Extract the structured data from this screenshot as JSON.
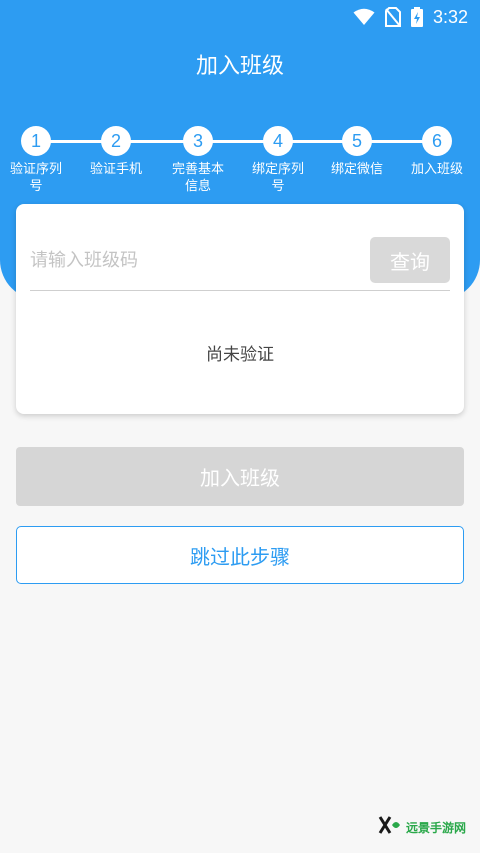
{
  "status_bar": {
    "time": "3:32",
    "icons": [
      "wifi-icon",
      "no-sim-icon",
      "battery-charging-icon"
    ]
  },
  "header": {
    "title": "加入班级",
    "accent_color": "#2d9cf2"
  },
  "steps": [
    {
      "number": "1",
      "label": "验证序列号"
    },
    {
      "number": "2",
      "label": "验证手机"
    },
    {
      "number": "3",
      "label": "完善基本信息"
    },
    {
      "number": "4",
      "label": "绑定序列号"
    },
    {
      "number": "5",
      "label": "绑定微信"
    },
    {
      "number": "6",
      "label": "加入班级"
    }
  ],
  "card": {
    "input_placeholder": "请输入班级码",
    "input_value": "",
    "query_label": "查询",
    "status_text": "尚未验证"
  },
  "actions": {
    "join_label": "加入班级",
    "skip_label": "跳过此步骤"
  },
  "watermark": {
    "text": "远景手游网"
  }
}
